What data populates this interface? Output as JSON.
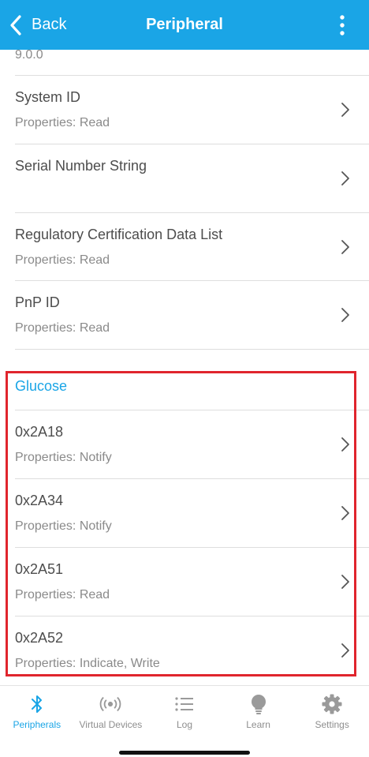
{
  "navbar": {
    "back_label": "Back",
    "title": "Peripheral",
    "accent_color": "#1aa5e6"
  },
  "content": {
    "version_tail": "9.0.0",
    "device_info_rows": [
      {
        "title": "System ID",
        "properties": "Properties: Read"
      },
      {
        "title": "Serial Number String",
        "properties": ""
      },
      {
        "title": "Regulatory Certification Data List",
        "properties": "Properties: Read"
      },
      {
        "title": "PnP ID",
        "properties": "Properties: Read"
      }
    ],
    "glucose_section": {
      "title": "Glucose",
      "rows": [
        {
          "title": "0x2A18",
          "properties": "Properties: Notify"
        },
        {
          "title": "0x2A34",
          "properties": "Properties: Notify"
        },
        {
          "title": "0x2A51",
          "properties": "Properties: Read"
        },
        {
          "title": "0x2A52",
          "properties": "Properties: Indicate, Write"
        }
      ],
      "highlight_color": "#e0252d"
    }
  },
  "tabbar": {
    "tabs": [
      {
        "label": "Peripherals",
        "icon": "bluetooth-icon",
        "active": true
      },
      {
        "label": "Virtual Devices",
        "icon": "broadcast-icon",
        "active": false
      },
      {
        "label": "Log",
        "icon": "list-icon",
        "active": false
      },
      {
        "label": "Learn",
        "icon": "lightbulb-icon",
        "active": false
      },
      {
        "label": "Settings",
        "icon": "gear-icon",
        "active": false
      }
    ]
  }
}
